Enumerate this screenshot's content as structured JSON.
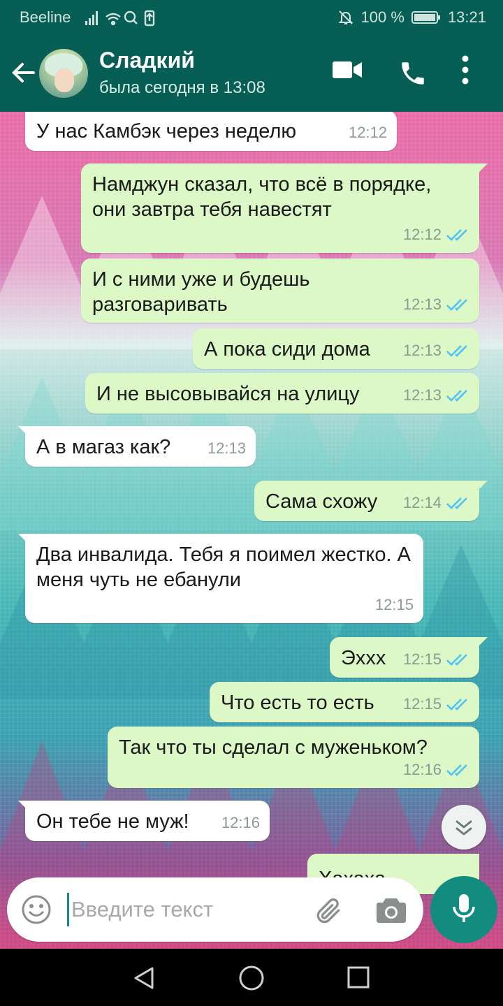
{
  "status_bar": {
    "carrier": "Beeline",
    "battery": "100 %",
    "time": "13:21"
  },
  "header": {
    "contact_name": "Сладкий",
    "last_seen": "была сегодня в 13:08"
  },
  "messages": [
    {
      "direction": "in",
      "text": "У нас Камбэк через неделю",
      "time": "12:12"
    },
    {
      "direction": "out",
      "text": "Намджун сказал, что всё в порядке, они завтра тебя навестят",
      "time": "12:12",
      "read": true
    },
    {
      "direction": "out",
      "text": "И с ними уже и будешь разговаривать",
      "time": "12:13",
      "read": true
    },
    {
      "direction": "out",
      "text": "А пока сиди дома",
      "time": "12:13",
      "read": true
    },
    {
      "direction": "out",
      "text": "И не высовывайся на улицу",
      "time": "12:13",
      "read": true
    },
    {
      "direction": "in",
      "text": "А в магаз как?",
      "time": "12:13"
    },
    {
      "direction": "out",
      "text": "Сама схожу",
      "time": "12:14",
      "read": true
    },
    {
      "direction": "in",
      "text": "Два инвалида. Тебя я поимел жестко. А меня чуть не ебанули",
      "time": "12:15"
    },
    {
      "direction": "out",
      "text": "Эххх",
      "time": "12:15",
      "read": true
    },
    {
      "direction": "out",
      "text": "Что есть то есть",
      "time": "12:15",
      "read": true
    },
    {
      "direction": "out",
      "text": "Так что ты сделал с муженьком?",
      "time": "12:16",
      "read": true
    },
    {
      "direction": "in",
      "text": "Он тебе не муж!",
      "time": "12:16"
    },
    {
      "direction": "out",
      "text": "Хахаха",
      "time": "",
      "partial": true
    }
  ],
  "input": {
    "placeholder": "Введите текст"
  },
  "colors": {
    "header": "#075e54",
    "outgoing_bubble": "#dcf8c6",
    "incoming_bubble": "#ffffff",
    "accent": "#128c7e",
    "read_ticks": "#4fc3f7"
  }
}
